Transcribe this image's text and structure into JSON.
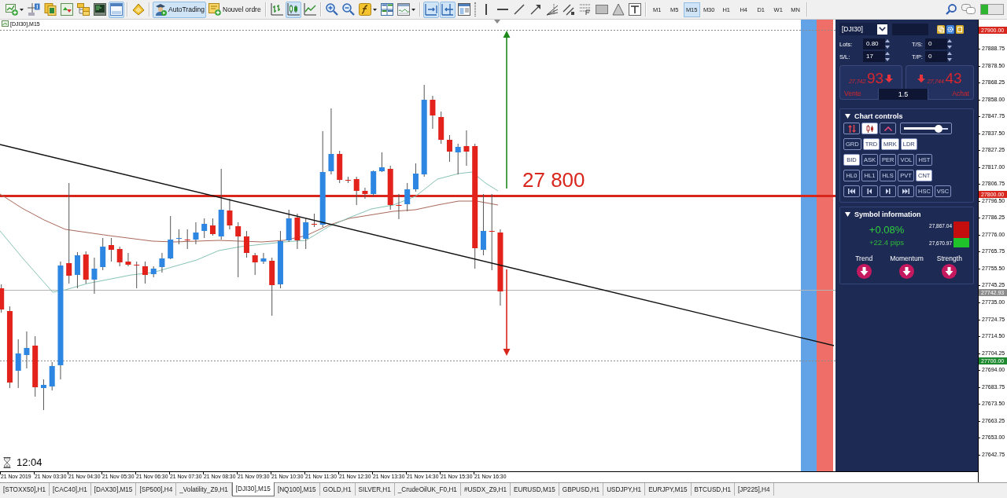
{
  "toolbar": {
    "groups": [
      [
        {
          "kind": "new-chart",
          "pressed": false
        },
        {
          "kind": "data-window",
          "pressed": false
        },
        {
          "kind": "profiles",
          "pressed": false
        },
        {
          "kind": "market-watch",
          "pressed": false
        },
        {
          "kind": "navigator",
          "pressed": false
        },
        {
          "kind": "terminal",
          "pressed": false
        },
        {
          "kind": "tester",
          "pressed": true
        }
      ],
      [
        {
          "kind": "editor",
          "pressed": false
        }
      ],
      [
        {
          "kind": "autotrading",
          "label": "AutoTrading",
          "pressed": true
        },
        {
          "kind": "new-order",
          "label": "Nouvel ordre",
          "pressed": false
        }
      ],
      [
        {
          "kind": "bar-chart",
          "pressed": false
        },
        {
          "kind": "candle-chart",
          "pressed": true
        },
        {
          "kind": "line-chart",
          "pressed": false
        }
      ],
      [
        {
          "kind": "zoom-in",
          "pressed": false
        },
        {
          "kind": "zoom-out",
          "pressed": false
        },
        {
          "kind": "indicators",
          "pressed": false
        },
        {
          "kind": "tile-windows",
          "pressed": false
        },
        {
          "kind": "templates",
          "pressed": false
        }
      ],
      [
        {
          "kind": "chart-shift",
          "pressed": true
        },
        {
          "kind": "autoscroll",
          "pressed": true
        },
        {
          "kind": "properties",
          "pressed": false
        }
      ],
      [
        {
          "kind": "vertical-line",
          "pressed": false
        },
        {
          "kind": "horizontal-line",
          "pressed": false
        },
        {
          "kind": "trend-line",
          "pressed": false
        },
        {
          "kind": "arrow-line",
          "pressed": false
        },
        {
          "kind": "fan",
          "pressed": false
        },
        {
          "kind": "channel",
          "pressed": false
        },
        {
          "kind": "fibonacci",
          "pressed": false
        },
        {
          "kind": "rectangle",
          "pressed": false
        },
        {
          "kind": "triangle",
          "pressed": false
        },
        {
          "kind": "text-label",
          "pressed": false
        }
      ]
    ],
    "timeframes": [
      {
        "label": "M1",
        "selected": false
      },
      {
        "label": "M5",
        "selected": false
      },
      {
        "label": "M15",
        "selected": true
      },
      {
        "label": "M30",
        "selected": false
      },
      {
        "label": "H1",
        "selected": false
      },
      {
        "label": "H4",
        "selected": false
      },
      {
        "label": "D1",
        "selected": false
      },
      {
        "label": "W1",
        "selected": false
      },
      {
        "label": "MN",
        "selected": false
      }
    ]
  },
  "chart": {
    "title": "[DJI30],M15",
    "annotation": "27 800",
    "clock": "12:04",
    "price_axis": {
      "ticks": [
        "27888.75",
        "27878.50",
        "27868.25",
        "27858.00",
        "27847.75",
        "27837.50",
        "27827.25",
        "27817.00",
        "27806.75",
        "27796.50",
        "27786.25",
        "27776.00",
        "27765.75",
        "27755.50",
        "27745.25",
        "27735.00",
        "27724.75",
        "27714.50",
        "27704.25",
        "27694.00",
        "27683.75",
        "27673.50",
        "27663.25",
        "27653.00",
        "27642.75"
      ],
      "markers": [
        {
          "kind": "top",
          "label": "27900.00",
          "color": "#d9261c"
        },
        {
          "kind": "level",
          "label": "27800.00",
          "color": "#d9261c"
        },
        {
          "kind": "bid",
          "label": "27742.93",
          "color": "#8c8c8c"
        },
        {
          "kind": "bottom",
          "label": "27700.00",
          "color": "#1e8a30"
        }
      ]
    },
    "time_axis": {
      "labels": [
        "21 Nov 2019",
        "21 Nov 03:30",
        "21 Nov 04:30",
        "21 Nov 05:30",
        "21 Nov 06:30",
        "21 Nov 07:30",
        "21 Nov 08:30",
        "21 Nov 09:30",
        "21 Nov 10:30",
        "21 Nov 11:30",
        "21 Nov 12:30",
        "21 Nov 13:30",
        "21 Nov 14:30",
        "21 Nov 15:30",
        "21 Nov 16:30"
      ]
    }
  },
  "trade_panel": {
    "symbol": "[DJI30]",
    "fields": [
      {
        "label": "Lots:",
        "value": "0.80"
      },
      {
        "label": "T/S:",
        "value": "0"
      },
      {
        "label": "S/L:",
        "value": "17"
      },
      {
        "label": "T/P:",
        "value": "0"
      }
    ],
    "sell": {
      "price_main": "27,742.",
      "price_pips": "93",
      "label": "Vente"
    },
    "buy": {
      "price_main": "27,744.",
      "price_pips": "43",
      "label": "Achat"
    },
    "spread": "1.5",
    "chart_controls": {
      "title": "Chart controls",
      "expanded": true,
      "tools": [
        {
          "kind": "sort",
          "selected": false
        },
        {
          "kind": "candles",
          "selected": true
        },
        {
          "kind": "caret",
          "selected": false
        }
      ],
      "slider": {
        "level": 0.78
      },
      "toggle_rows": [
        [
          {
            "label": "GRD",
            "selected": false
          },
          {
            "label": "TRD",
            "selected": true
          },
          {
            "label": "MRK",
            "selected": true
          },
          {
            "label": "LDR",
            "selected": true
          }
        ],
        [
          {
            "label": "BID",
            "selected": true
          },
          {
            "label": "ASK",
            "selected": false
          },
          {
            "label": "PER",
            "selected": false
          },
          {
            "label": "VOL",
            "selected": false
          },
          {
            "label": "HST",
            "selected": false
          }
        ],
        [
          {
            "label": "HL0",
            "selected": false
          },
          {
            "label": "HL1",
            "selected": false
          },
          {
            "label": "HLS",
            "selected": false
          },
          {
            "label": "PVT",
            "selected": false
          },
          {
            "label": "CNT",
            "selected": true
          }
        ]
      ],
      "scale_toggles": [
        {
          "label": "HSC",
          "selected": false
        },
        {
          "label": "VSC",
          "selected": false
        }
      ]
    },
    "symbol_information": {
      "title": "Symbol information",
      "expanded": true,
      "change_percent": "+0.08%",
      "change_pips": "+22.4 pips",
      "high": "27,867.04",
      "low": "27,670.97",
      "range": {
        "level": 0.37
      },
      "signals": [
        {
          "label": "Trend",
          "rising": false
        },
        {
          "label": "Momentum",
          "rising": false
        },
        {
          "label": "Strength",
          "rising": false
        }
      ]
    }
  },
  "chart_tabs": [
    {
      "label": "[STOXX50],H1",
      "selected": false
    },
    {
      "label": "[CAC40],H1",
      "selected": false
    },
    {
      "label": "[DAX30],M15",
      "selected": false
    },
    {
      "label": "[SP500],H4",
      "selected": false
    },
    {
      "label": "_Volatility_Z9,H1",
      "selected": false
    },
    {
      "label": "[DJI30],M15",
      "selected": true
    },
    {
      "label": "[NQ100],M15",
      "selected": false
    },
    {
      "label": "GOLD,H1",
      "selected": false
    },
    {
      "label": "SILVER,H1",
      "selected": false
    },
    {
      "label": "_CrudeOilUK_F0,H1",
      "selected": false
    },
    {
      "label": "#USDX_Z9,H1",
      "selected": false
    },
    {
      "label": "EURUSD,M15",
      "selected": false
    },
    {
      "label": "GBPUSD,H1",
      "selected": false
    },
    {
      "label": "USDJPY,H1",
      "selected": false
    },
    {
      "label": "EURJPY,M15",
      "selected": false
    },
    {
      "label": "BTCUSD,H1",
      "selected": false
    },
    {
      "label": "[JP225],H4",
      "selected": false
    }
  ]
}
